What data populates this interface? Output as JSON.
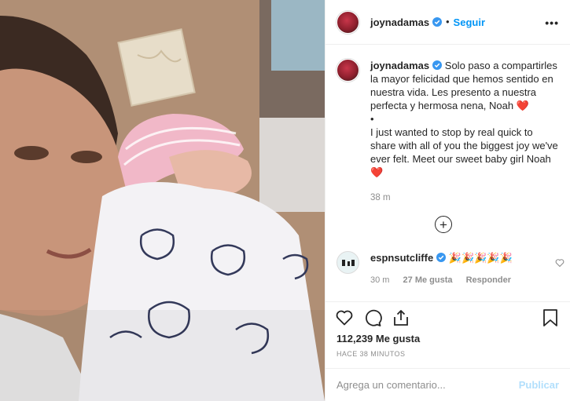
{
  "header": {
    "username": "joynadamas",
    "separator": "•",
    "follow_label": "Seguir",
    "more_label": "•••"
  },
  "caption": {
    "username": "joynadamas",
    "text_es": "Solo paso a compartirles la mayor felicidad que hemos sentido en nuestra vida. Les presento a nuestra perfecta y hermosa nena, Noah",
    "bullet": "•",
    "text_en": "I just wanted to stop by real quick to share with all of you the biggest joy we've ever felt. Meet our sweet baby girl Noah",
    "heart": "❤️",
    "time": "38 m"
  },
  "load_more": {
    "label": "+"
  },
  "comment": {
    "username": "espnsutcliffe",
    "text": "🎉🎉🎉🎉🎉",
    "time": "30 m",
    "likes": "27 Me gusta",
    "reply": "Responder"
  },
  "likes": "112,239 Me gusta",
  "timestamp": "HACE 38 MINUTOS",
  "add_comment": {
    "placeholder": "Agrega un comentario...",
    "publish_label": "Publicar"
  },
  "colors": {
    "accent": "#0095f6",
    "publish_disabled": "#b2dffc",
    "heart": "#e0222b",
    "muted": "#8e8e8e"
  },
  "icons": [
    "verified-badge-icon",
    "more-icon",
    "plus-circle-icon",
    "heart-icon",
    "comment-icon",
    "share-icon",
    "bookmark-icon"
  ]
}
